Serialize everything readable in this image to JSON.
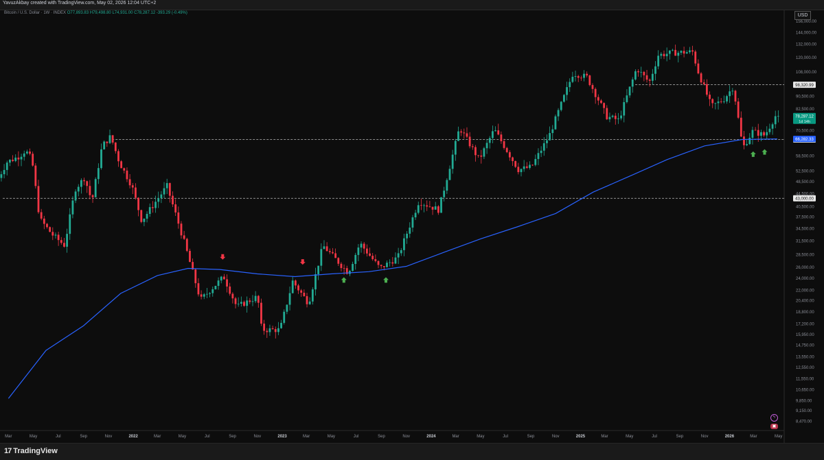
{
  "header": {
    "text": "YavuzAkbay created with TradingView.com, May 02, 2026 12:04 UTC+2"
  },
  "legend": {
    "symbol": "Bitcoin / U.S. Dollar · 1W · INDEX",
    "o": "O77,893.83",
    "h": "H79,498.80",
    "l": "L74,931.00",
    "c": "C78,287.12",
    "change": "-393.29 (-0.49%)"
  },
  "currency": "USD",
  "footer": {
    "brand": "TradingView",
    "logo_mark": "17"
  },
  "icons": [
    "lightning-icon",
    "event-badge-icon"
  ],
  "colors": {
    "up": "#22ab94",
    "down": "#f23645",
    "ma": "#2962ff",
    "bg": "#0d0d0d"
  },
  "chart_data": {
    "type": "candlestick",
    "interval": "1W",
    "scale": "log",
    "ylim": [
      8000,
      165000
    ],
    "y_ticks": [
      156000,
      144000,
      132000,
      120000,
      108000,
      98320.99,
      90500,
      82500,
      78287.12,
      70500,
      66282.33,
      66000,
      58500,
      52500,
      48500,
      44500,
      43000,
      40500,
      37500,
      34500,
      31500,
      28500,
      26000,
      24000,
      22000,
      20400,
      18800,
      17200,
      15950,
      14750,
      13550,
      12550,
      11550,
      10650,
      9850,
      9150,
      8470
    ],
    "x_ticks": [
      "Mar",
      "May",
      "Jul",
      "Sep",
      "Nov",
      "2022",
      "Mar",
      "May",
      "Jul",
      "Sep",
      "Nov",
      "2023",
      "Mar",
      "May",
      "Jul",
      "Sep",
      "Nov",
      "2024",
      "Mar",
      "May",
      "Jul",
      "Sep",
      "Nov",
      "2025",
      "Mar",
      "May",
      "Jul",
      "Sep",
      "Nov",
      "2026",
      "Mar",
      "May"
    ],
    "x_tick_dates": [
      "2021-03-01",
      "2021-05-01",
      "2021-07-01",
      "2021-09-01",
      "2021-11-01",
      "2022-01-01",
      "2022-03-01",
      "2022-05-01",
      "2022-07-01",
      "2022-09-01",
      "2022-11-01",
      "2023-01-01",
      "2023-03-01",
      "2023-05-01",
      "2023-07-01",
      "2023-09-01",
      "2023-11-01",
      "2024-01-01",
      "2024-03-01",
      "2024-05-01",
      "2024-07-01",
      "2024-09-01",
      "2024-11-01",
      "2025-01-01",
      "2025-03-01",
      "2025-05-01",
      "2025-07-01",
      "2025-09-01",
      "2025-11-01",
      "2026-01-01",
      "2026-03-01",
      "2026-05-01"
    ],
    "price_path": [
      [
        "2021-02-01",
        48000
      ],
      [
        "2021-03-01",
        56000
      ],
      [
        "2021-04-01",
        58500
      ],
      [
        "2021-04-15",
        61000
      ],
      [
        "2021-05-01",
        57000
      ],
      [
        "2021-05-20",
        37000
      ],
      [
        "2021-06-20",
        33000
      ],
      [
        "2021-07-20",
        30500
      ],
      [
        "2021-08-15",
        46000
      ],
      [
        "2021-09-07",
        50000
      ],
      [
        "2021-09-25",
        42000
      ],
      [
        "2021-10-20",
        63000
      ],
      [
        "2021-11-10",
        67500
      ],
      [
        "2021-12-01",
        56000
      ],
      [
        "2022-01-01",
        47000
      ],
      [
        "2022-01-25",
        36500
      ],
      [
        "2022-03-28",
        47000
      ],
      [
        "2022-05-10",
        31000
      ],
      [
        "2022-06-18",
        20500
      ],
      [
        "2022-08-14",
        24300
      ],
      [
        "2022-09-15",
        19500
      ],
      [
        "2022-11-05",
        21000
      ],
      [
        "2022-11-15",
        16500
      ],
      [
        "2022-12-30",
        16500
      ],
      [
        "2023-01-30",
        23500
      ],
      [
        "2023-03-10",
        20000
      ],
      [
        "2023-04-14",
        30500
      ],
      [
        "2023-06-15",
        25000
      ],
      [
        "2023-07-14",
        31000
      ],
      [
        "2023-09-01",
        25800
      ],
      [
        "2023-10-15",
        28000
      ],
      [
        "2023-12-05",
        42000
      ],
      [
        "2024-01-23",
        39500
      ],
      [
        "2024-03-14",
        72000
      ],
      [
        "2024-05-01",
        57000
      ],
      [
        "2024-06-07",
        71000
      ],
      [
        "2024-08-05",
        53000
      ],
      [
        "2024-09-06",
        54000
      ],
      [
        "2024-10-20",
        68000
      ],
      [
        "2024-12-17",
        107000
      ],
      [
        "2025-01-20",
        104000
      ],
      [
        "2025-03-10",
        78000
      ],
      [
        "2025-04-08",
        76000
      ],
      [
        "2025-05-22",
        111000
      ],
      [
        "2025-06-22",
        100000
      ],
      [
        "2025-07-14",
        122000
      ],
      [
        "2025-08-14",
        124000
      ],
      [
        "2025-10-06",
        125000
      ],
      [
        "2025-10-20",
        108000
      ],
      [
        "2025-11-21",
        84000
      ],
      [
        "2025-12-20",
        88000
      ],
      [
        "2026-01-14",
        97000
      ],
      [
        "2026-02-06",
        62000
      ],
      [
        "2026-03-02",
        70000
      ],
      [
        "2026-04-01",
        68000
      ],
      [
        "2026-04-27",
        78287.12
      ]
    ],
    "horizontal_levels": [
      {
        "label": "98,320.99",
        "value": 98320.99
      },
      {
        "label": "66,000.00",
        "value": 66000
      },
      {
        "label": "43,000.00",
        "value": 43000
      }
    ],
    "price_labels": [
      {
        "label": "78,287.12",
        "sublabel": "1d 14h",
        "value": 78287.12
      },
      {
        "label": "66,282.33",
        "value": 66282.33
      }
    ],
    "moving_average": {
      "points": [
        [
          "2021-03-01",
          10000
        ],
        [
          "2021-06-01",
          14200
        ],
        [
          "2021-09-01",
          17000
        ],
        [
          "2021-12-01",
          21500
        ],
        [
          "2022-03-01",
          24500
        ],
        [
          "2022-05-15",
          25800
        ],
        [
          "2022-08-01",
          25600
        ],
        [
          "2022-11-01",
          24800
        ],
        [
          "2023-02-01",
          24300
        ],
        [
          "2023-05-01",
          24800
        ],
        [
          "2023-08-01",
          25200
        ],
        [
          "2023-11-01",
          26200
        ],
        [
          "2024-02-01",
          29000
        ],
        [
          "2024-05-01",
          32000
        ],
        [
          "2024-08-01",
          35000
        ],
        [
          "2024-11-01",
          38500
        ],
        [
          "2025-02-01",
          45000
        ],
        [
          "2025-05-01",
          50500
        ],
        [
          "2025-08-01",
          57000
        ],
        [
          "2025-11-01",
          63000
        ],
        [
          "2026-02-01",
          66000
        ],
        [
          "2026-04-28",
          66282.33
        ]
      ]
    },
    "markers": [
      {
        "date": "2022-08-08",
        "value": 27500,
        "dir": "down"
      },
      {
        "date": "2023-02-20",
        "value": 26500,
        "dir": "down"
      },
      {
        "date": "2023-06-01",
        "value": 24200,
        "dir": "up"
      },
      {
        "date": "2023-09-12",
        "value": 24200,
        "dir": "up"
      },
      {
        "date": "2026-02-28",
        "value": 60500,
        "dir": "up"
      },
      {
        "date": "2026-03-28",
        "value": 61500,
        "dir": "up"
      }
    ],
    "grid": false,
    "legend_position": "top-left"
  }
}
